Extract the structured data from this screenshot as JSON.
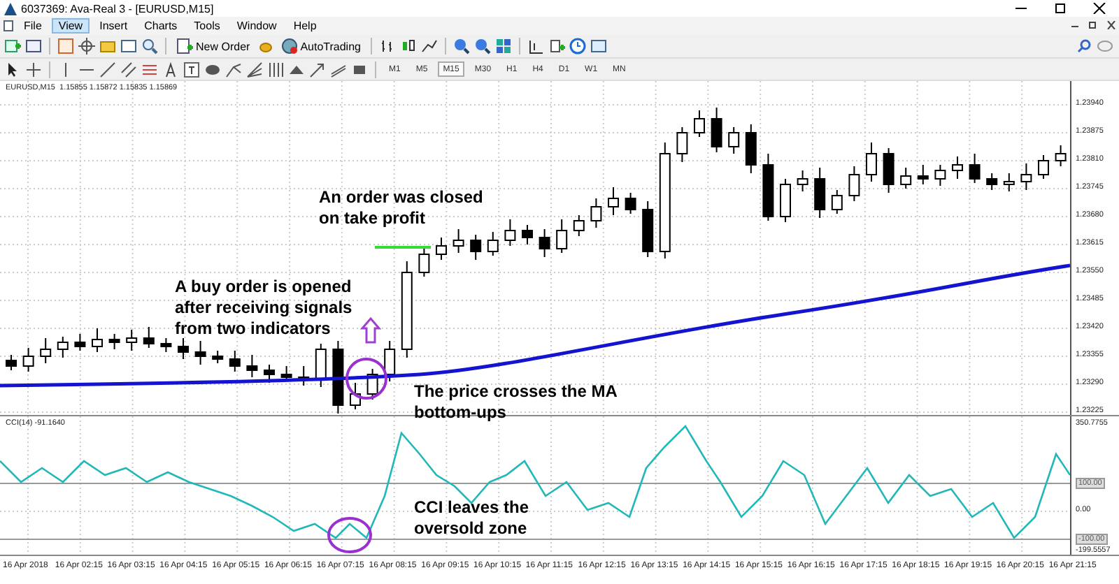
{
  "window": {
    "title": "6037369: Ava-Real 3 - [EURUSD,M15]"
  },
  "menu": [
    {
      "label": "File",
      "selected": false
    },
    {
      "label": "View",
      "selected": true
    },
    {
      "label": "Insert",
      "selected": false
    },
    {
      "label": "Charts",
      "selected": false
    },
    {
      "label": "Tools",
      "selected": false
    },
    {
      "label": "Window",
      "selected": false
    },
    {
      "label": "Help",
      "selected": false
    }
  ],
  "toolbar": {
    "buttons": [
      {
        "label": "New Order"
      },
      {
        "label": "AutoTrading"
      }
    ]
  },
  "timeframes": [
    {
      "label": "M1",
      "selected": false
    },
    {
      "label": "M5",
      "selected": false
    },
    {
      "label": "M15",
      "selected": true
    },
    {
      "label": "M30",
      "selected": false
    },
    {
      "label": "H1",
      "selected": false
    },
    {
      "label": "H4",
      "selected": false
    },
    {
      "label": "D1",
      "selected": false
    },
    {
      "label": "W1",
      "selected": false
    },
    {
      "label": "MN",
      "selected": false
    }
  ],
  "chart": {
    "header": "EURUSD,M15  1.15855 1.15872 1.15835 1.15869",
    "price_labels": [
      "1.23940",
      "1.23875",
      "1.23810",
      "1.23745",
      "1.23680",
      "1.23615",
      "1.23550",
      "1.23485",
      "1.23420",
      "1.23355",
      "1.23290",
      "1.23225"
    ],
    "annotations": [
      "An order was closed\non take profit",
      "A buy order is opened\nafter receiving signals\nfrom two indicators",
      "The price crosses the MA\nbottom-ups",
      "CCI leaves the\noversold zone"
    ]
  },
  "indicator": {
    "header": "CCI(14) -91.1640",
    "scale_labels": [
      {
        "text": "350.7755",
        "kind": "plain"
      },
      {
        "text": "100.00",
        "kind": "level"
      },
      {
        "text": "0.00",
        "kind": "plain"
      },
      {
        "text": "-100.00",
        "kind": "level"
      },
      {
        "text": "-199.5557",
        "kind": "plain"
      }
    ]
  },
  "time_labels": [
    "16 Apr 2018",
    "16 Apr 02:15",
    "16 Apr 03:15",
    "16 Apr 04:15",
    "16 Apr 05:15",
    "16 Apr 06:15",
    "16 Apr 07:15",
    "16 Apr 08:15",
    "16 Apr 09:15",
    "16 Apr 10:15",
    "16 Apr 11:15",
    "16 Apr 12:15",
    "16 Apr 13:15",
    "16 Apr 14:15",
    "16 Apr 15:15",
    "16 Apr 16:15",
    "16 Apr 17:15",
    "16 Apr 18:15",
    "16 Apr 19:15",
    "16 Apr 20:15",
    "16 Apr 21:15"
  ]
}
